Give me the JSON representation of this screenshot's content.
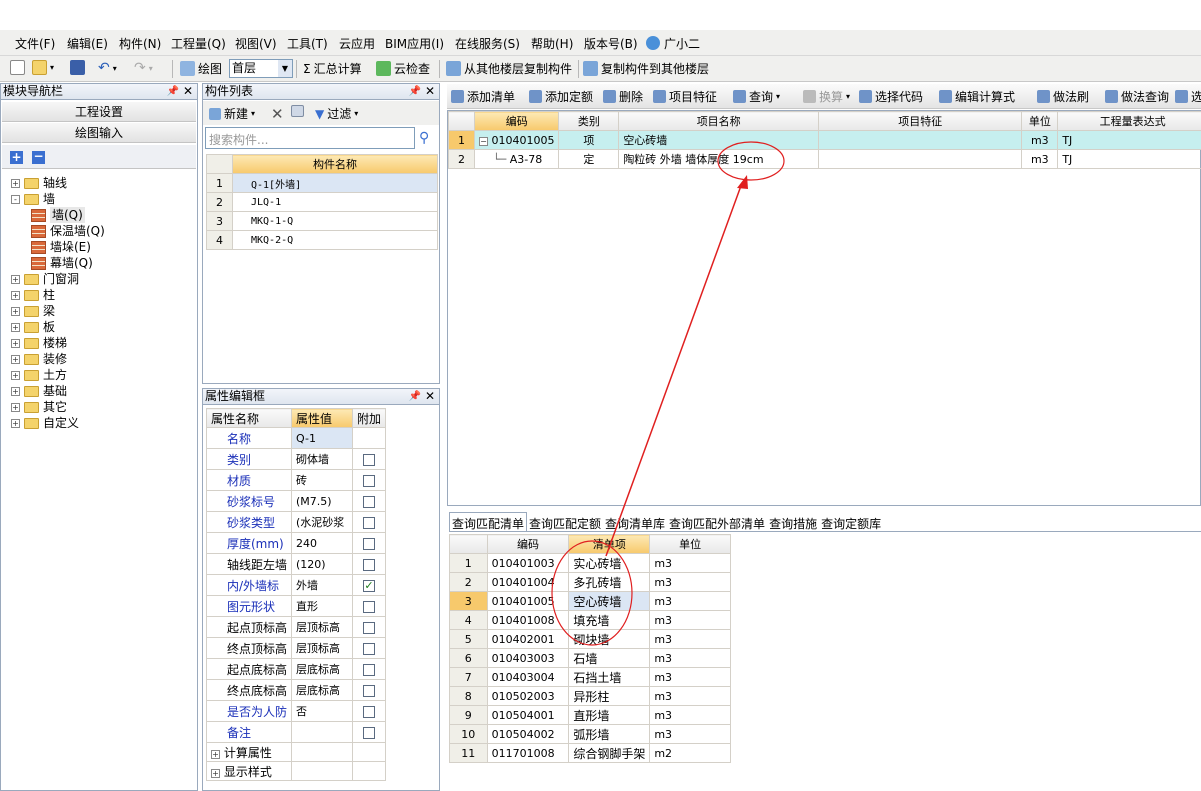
{
  "menu": [
    "文件(F)",
    "编辑(E)",
    "构件(N)",
    "工程量(Q)",
    "视图(V)",
    "工具(T)",
    "云应用",
    "BIM应用(I)",
    "在线服务(S)",
    "帮助(H)",
    "版本号(B)",
    "广小二"
  ],
  "toolbar1": {
    "draw": "绘图",
    "floor": "首层",
    "sum": "汇总计算",
    "cloudcheck": "云检查",
    "copyfrom": "从其他楼层复制构件",
    "copyto": "复制构件到其他楼层"
  },
  "nav": {
    "title": "模块导航栏",
    "btn1": "工程设置",
    "btn2": "绘图输入",
    "tree": [
      {
        "label": "轴线",
        "level": 0,
        "pm": "+",
        "kind": "folder"
      },
      {
        "label": "墙",
        "level": 0,
        "pm": "-",
        "kind": "folder"
      },
      {
        "label": "墙(Q)",
        "level": 1,
        "kind": "wall"
      },
      {
        "label": "保温墙(Q)",
        "level": 1,
        "kind": "wall"
      },
      {
        "label": "墙垛(E)",
        "level": 1,
        "kind": "wall"
      },
      {
        "label": "幕墙(Q)",
        "level": 1,
        "kind": "wall"
      },
      {
        "label": "门窗洞",
        "level": 0,
        "pm": "+",
        "kind": "folder"
      },
      {
        "label": "柱",
        "level": 0,
        "pm": "+",
        "kind": "folder"
      },
      {
        "label": "梁",
        "level": 0,
        "pm": "+",
        "kind": "folder"
      },
      {
        "label": "板",
        "level": 0,
        "pm": "+",
        "kind": "folder"
      },
      {
        "label": "楼梯",
        "level": 0,
        "pm": "+",
        "kind": "folder"
      },
      {
        "label": "装修",
        "level": 0,
        "pm": "+",
        "kind": "folder"
      },
      {
        "label": "土方",
        "level": 0,
        "pm": "+",
        "kind": "folder"
      },
      {
        "label": "基础",
        "level": 0,
        "pm": "+",
        "kind": "folder"
      },
      {
        "label": "其它",
        "level": 0,
        "pm": "+",
        "kind": "folder"
      },
      {
        "label": "自定义",
        "level": 0,
        "pm": "+",
        "kind": "folder"
      }
    ]
  },
  "complist": {
    "title": "构件列表",
    "new": "新建",
    "filter": "过滤",
    "search_placeholder": "搜索构件...",
    "header": "构件名称",
    "rows": [
      {
        "n": "1",
        "name": "Q-1[外墙]"
      },
      {
        "n": "2",
        "name": "JLQ-1"
      },
      {
        "n": "3",
        "name": "MKQ-1-Q"
      },
      {
        "n": "4",
        "name": "MKQ-2-Q"
      }
    ]
  },
  "props": {
    "title": "属性编辑框",
    "h1": "属性名称",
    "h2": "属性值",
    "h3": "附加",
    "rows": [
      {
        "name": "名称",
        "value": "Q-1",
        "blue": true,
        "chk": null
      },
      {
        "name": "类别",
        "value": "砌体墙",
        "blue": true,
        "chk": false
      },
      {
        "name": "材质",
        "value": "砖",
        "blue": true,
        "chk": false
      },
      {
        "name": "砂浆标号",
        "value": "(M7.5)",
        "blue": true,
        "chk": false
      },
      {
        "name": "砂浆类型",
        "value": "(水泥砂浆",
        "blue": true,
        "chk": false
      },
      {
        "name": "厚度(mm)",
        "value": "240",
        "blue": true,
        "chk": false
      },
      {
        "name": "轴线距左墙",
        "value": "(120)",
        "blue": false,
        "chk": false
      },
      {
        "name": "内/外墙标",
        "value": "外墙",
        "blue": true,
        "chk": true
      },
      {
        "name": "图元形状",
        "value": "直形",
        "blue": true,
        "chk": false
      },
      {
        "name": "起点顶标高",
        "value": "层顶标高",
        "blue": false,
        "chk": false
      },
      {
        "name": "终点顶标高",
        "value": "层顶标高",
        "blue": false,
        "chk": false
      },
      {
        "name": "起点底标高",
        "value": "层底标高",
        "blue": false,
        "chk": false
      },
      {
        "name": "终点底标高",
        "value": "层底标高",
        "blue": false,
        "chk": false
      },
      {
        "name": "是否为人防",
        "value": "否",
        "blue": true,
        "chk": false
      },
      {
        "name": "备注",
        "value": "",
        "blue": true,
        "chk": false
      }
    ],
    "extra": [
      "计算属性",
      "显示样式"
    ]
  },
  "rtool": [
    "添加清单",
    "添加定额",
    "删除",
    "项目特征",
    "查询",
    "换算",
    "选择代码",
    "编辑计算式",
    "做法刷",
    "做法查询",
    "选"
  ],
  "upper": {
    "headers": [
      "编码",
      "类别",
      "项目名称",
      "项目特征",
      "单位",
      "工程量表达式"
    ],
    "rows": [
      {
        "n": "1",
        "code": "010401005",
        "type": "项",
        "name": "空心砖墙",
        "feat": "",
        "unit": "m3",
        "expr": "TJ"
      },
      {
        "n": "2",
        "code": "A3-78",
        "type": "定",
        "name": "陶粒砖 外墙 墙体厚度 19cm",
        "feat": "",
        "unit": "m3",
        "expr": "TJ"
      }
    ]
  },
  "tabs": [
    "查询匹配清单",
    "查询匹配定额",
    "查询清单库",
    "查询匹配外部清单",
    "查询措施",
    "查询定额库"
  ],
  "lower": {
    "headers": [
      "编码",
      "清单项",
      "单位"
    ],
    "rows": [
      {
        "n": "1",
        "code": "010401003",
        "name": "实心砖墙",
        "unit": "m3"
      },
      {
        "n": "2",
        "code": "010401004",
        "name": "多孔砖墙",
        "unit": "m3"
      },
      {
        "n": "3",
        "code": "010401005",
        "name": "空心砖墙",
        "unit": "m3"
      },
      {
        "n": "4",
        "code": "010401008",
        "name": "填充墙",
        "unit": "m3"
      },
      {
        "n": "5",
        "code": "010402001",
        "name": "砌块墙",
        "unit": "m3"
      },
      {
        "n": "6",
        "code": "010403003",
        "name": "石墙",
        "unit": "m3"
      },
      {
        "n": "7",
        "code": "010403004",
        "name": "石挡土墙",
        "unit": "m3"
      },
      {
        "n": "8",
        "code": "010502003",
        "name": "异形柱",
        "unit": "m3"
      },
      {
        "n": "9",
        "code": "010504001",
        "name": "直形墙",
        "unit": "m3"
      },
      {
        "n": "10",
        "code": "010504002",
        "name": "弧形墙",
        "unit": "m3"
      },
      {
        "n": "11",
        "code": "011701008",
        "name": "综合钢脚手架",
        "unit": "m2"
      }
    ]
  },
  "colors": {
    "accent": "#f7c96c",
    "selected_row": "#c6efef",
    "annotation": "#e02020"
  }
}
